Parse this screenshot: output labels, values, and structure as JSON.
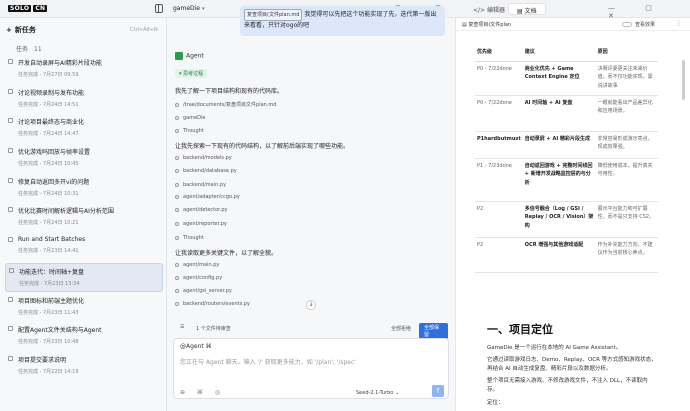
{
  "app": {
    "logo": "SOLO",
    "logo_badge": "CN",
    "project": "gameDie",
    "project_caret": "▾"
  },
  "topbar": {
    "tab_editor": "编辑器",
    "tab_docs": "文档",
    "tools": "⊞ ≡ ⊡",
    "window_controls": "— ▢ ✕"
  },
  "sidebar": {
    "new_task": "新任务",
    "new_task_icon": "+",
    "shortcut": "Ctrl+Alt+N",
    "task_label": "任务",
    "task_count": "11",
    "tasks": [
      {
        "title": "开发自动录屏与AI精彩片段功能",
        "meta": "任务完成 - 7月27日 09:59"
      },
      {
        "title": "讨论视频录制与发布功能",
        "meta": "任务完成 - 7月24日 14:51"
      },
      {
        "title": "讨论项目最终态与商业化",
        "meta": "任务完成 - 7月24日 14:47"
      },
      {
        "title": "优化游戏吗回放与帧率设置",
        "meta": "任务完成 - 7月24日 10:45"
      },
      {
        "title": "修复自动返回多开vi的问题",
        "meta": "任务完成 - 7月24日 10:31"
      },
      {
        "title": "优化比赛时间解析逻辑与AI分析范围",
        "meta": "任务完成 - 7月24日 10:21"
      },
      {
        "title": "Run and Start Batches",
        "meta": "任务完成 - 7月23日 14:41"
      },
      {
        "title": "功能迭代：时间轴+复盘",
        "meta": "任务完成 - 7月23日 13:34",
        "active": true
      },
      {
        "title": "项目图标和前端主题优化",
        "meta": "任务完成 - 7月23日 11:43"
      },
      {
        "title": "配置Agent文件关结构与Agent",
        "meta": "任务完成 - 7月23日 10:48"
      },
      {
        "title": "项目提交要求说明",
        "meta": "任务完成 - 7月22日 14:19"
      }
    ]
  },
  "chat": {
    "user_file": "复查项目(文件plan.md",
    "user_text": "我觉得可以先把这个功能实现了先，迭代第一版出来看看，只针对ogo的吧",
    "agent_name": "Agent",
    "think_label": "思考过程",
    "lines": [
      {
        "type": "text",
        "text": "我先了解一下项目结构和现有的代码库。"
      },
      {
        "type": "tool",
        "text": "/trae/documents/复盘项目文件plan.md"
      },
      {
        "type": "tool",
        "text": "gameDie"
      },
      {
        "type": "tool",
        "text": "Thought"
      },
      {
        "type": "text",
        "text": "让我先探索一下现有的代码结构，以了解前后端实现了哪些功能。"
      },
      {
        "type": "tool",
        "text": "backend/models.py"
      },
      {
        "type": "tool",
        "text": "backend/database.py"
      },
      {
        "type": "tool",
        "text": "backend/main.py"
      },
      {
        "type": "tool",
        "text": "agent/adapter/ccgo.py"
      },
      {
        "type": "tool",
        "text": "agent/detector.py"
      },
      {
        "type": "tool",
        "text": "agent/reporter.py"
      },
      {
        "type": "tool",
        "text": "Thought"
      },
      {
        "type": "text",
        "text": "让我读取更多关键文件，以了解全貌。"
      },
      {
        "type": "tool",
        "text": "agent/main.py"
      },
      {
        "type": "tool",
        "text": "agent/config.py"
      },
      {
        "type": "tool",
        "text": "agent/gsi_server.py"
      },
      {
        "type": "tool",
        "text": "backend/routers/events.py"
      }
    ],
    "scroll_down": "↓",
    "file_bar_label": "1 个文件待审查",
    "reject_all": "全部拒绝",
    "accept_all": "全部保留",
    "input_mention": "@Agent ⌘",
    "input_placeholder": "您正在与 Agent 聊天。输入 '/' 获取更多能力，如 '/plan', '/spec'",
    "input_icons": "⊕ ⌘ ◎",
    "model": "Seed-2.1-Turbo ⌄",
    "send": "↑"
  },
  "doc": {
    "file_name": "复查项目(文件plan",
    "preview_label": "查看效果",
    "more": "⋮",
    "table_headers": [
      "优先级",
      "建议",
      "原因"
    ],
    "table_rows": [
      [
        "P0 - 7/22done",
        "商业化优先 + Game Context Engine 定位",
        "决赛评委更关注未来价值，而不仅功能实现，需说讲故事"
      ],
      [
        "P0 - 7/22done",
        "AI 时间轴 + AI 复盘",
        "一眼就能看出产品差异化和应用场景。"
      ],
      [
        "P1hardbutmust",
        "自动录屏 + AI 精彩片段生成",
        "非常容易形成演示亮点，现成效果强。"
      ],
      [
        "P1 - 7/23done",
        "自动返回游戏 + 完整时间线回 + 新增开发战略监控层的与分析",
        "降低使用成本，提升真实可用性。"
      ],
      [
        "P2",
        "多信号融合（Log / GSI / Replay / OCR / Vision）架构",
        "展示平台能力和可扩展性，而不是只支持 CS2。"
      ],
      [
        "P2",
        "OCR 增强与其他游戏适配",
        "作为补充能力方向，不建议作为当前核心卖点。"
      ]
    ],
    "h1": "一、项目定位",
    "p1": "GameDie 是一个运行在本地的 AI Game Assistant。",
    "p2": "它通过读取游戏日志、Demo、Replay、OCR 等方式感知游戏状态，再结合 AI 自动生成复盘、精彩片段以及数据分析。",
    "p3": "整个项目无需接入游戏、不修改游戏文件，不注入 DLL，不读取内存。",
    "p4": "定位："
  }
}
